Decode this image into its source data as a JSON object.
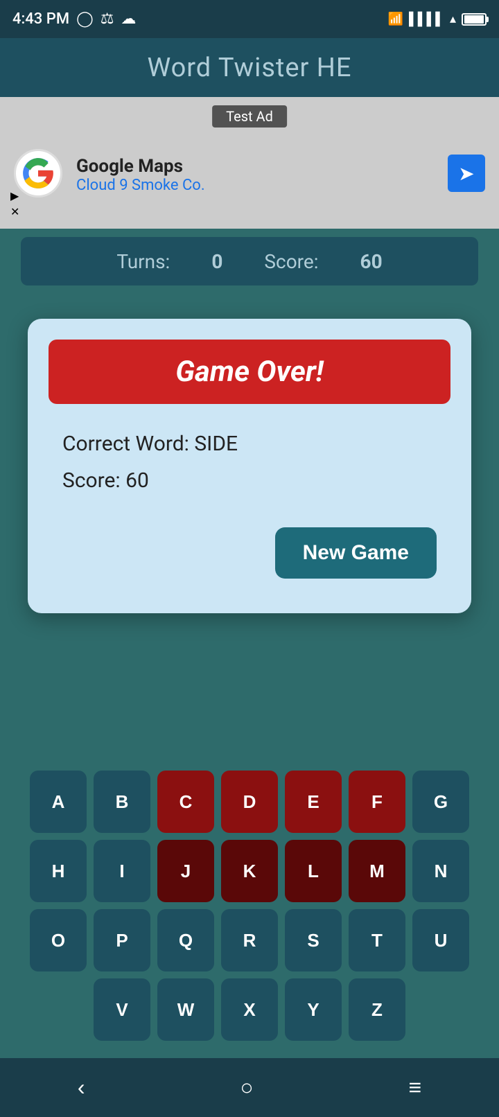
{
  "statusBar": {
    "time": "4:43 PM",
    "battery": "90"
  },
  "appTitle": "Word Twister HE",
  "adBanner": {
    "label": "Test Ad",
    "company": "Google Maps",
    "subtitle": "Cloud 9 Smoke Co."
  },
  "gameStats": {
    "turnsLabel": "Turns:",
    "turnsValue": "0",
    "scoreLabel": "Score:",
    "scoreValue": "60"
  },
  "modal": {
    "title": "Game Over!",
    "correctWordLabel": "Correct Word: SIDE",
    "scoreLabel": "Score: 60",
    "newGameButton": "New Game"
  },
  "keyboard": {
    "rows": [
      [
        "A",
        "B",
        "C",
        "D",
        "E",
        "F",
        "G"
      ],
      [
        "H",
        "I",
        "J",
        "K",
        "L",
        "M",
        "N"
      ],
      [
        "O",
        "P",
        "Q",
        "R",
        "S",
        "T",
        "U"
      ],
      [
        "V",
        "W",
        "X",
        "Y",
        "Z"
      ]
    ],
    "usedRed": [
      "C",
      "D",
      "E",
      "F",
      "J",
      "K",
      "L",
      "M"
    ],
    "usedDarkRed": []
  },
  "navBar": {
    "back": "‹",
    "home": "○",
    "menu": "≡"
  }
}
